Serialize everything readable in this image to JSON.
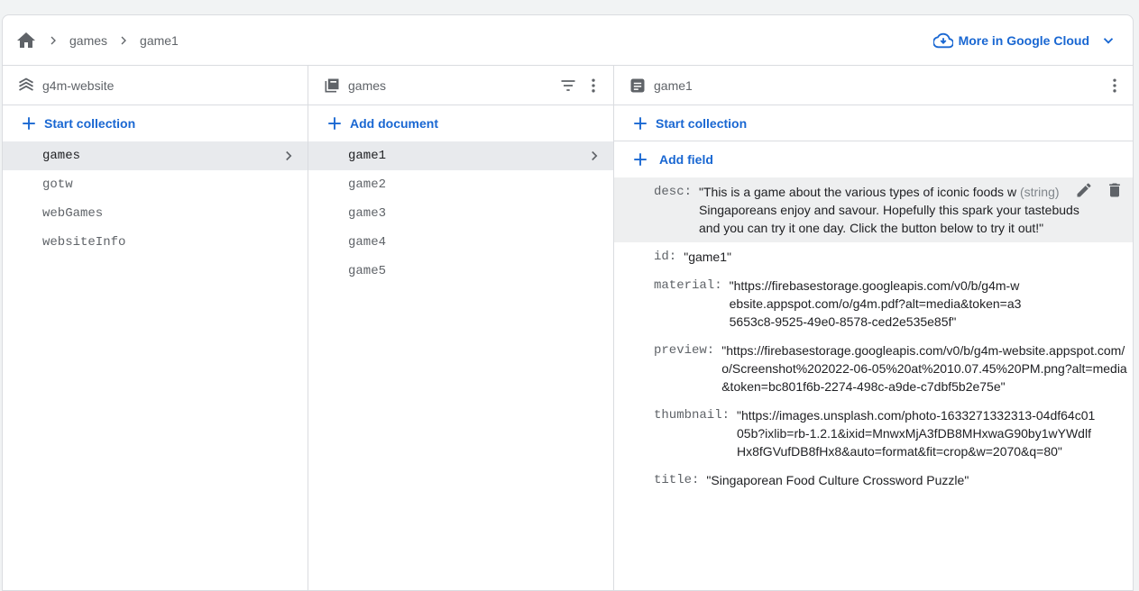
{
  "breadcrumb": [
    "games",
    "game1"
  ],
  "cloud_button": "More in Google Cloud",
  "columns": {
    "root": {
      "title": "g4m-website",
      "action": "Start collection",
      "items": [
        "games",
        "gotw",
        "webGames",
        "websiteInfo"
      ],
      "selected": "games"
    },
    "collection": {
      "title": "games",
      "action": "Add document",
      "items": [
        "game1",
        "game2",
        "game3",
        "game4",
        "game5"
      ],
      "selected": "game1"
    },
    "document": {
      "title": "game1",
      "action1": "Start collection",
      "action2": "Add field",
      "fields": [
        {
          "key": "desc:",
          "value": "\"This is a game about the various types of iconic foods w",
          "value_cont": "Singaporeans enjoy and savour. Hopefully this spark your tastebuds and you can try it one day. Click the button below to try it out!\"",
          "type": "(string)"
        },
        {
          "key": "id:",
          "value": "\"game1\""
        },
        {
          "key": "material:",
          "value": "\"https://firebasestorage.googleapis.com/v0/b/g4m-website.appspot.com/o/g4m.pdf?alt=media&token=a35653c8-9525-49e0-8578-ced2e535e85f\""
        },
        {
          "key": "preview:",
          "value": "\"https://firebasestorage.googleapis.com/v0/b/g4m-website.appspot.com/o/Screenshot%202022-06-05%20at%2010.07.45%20PM.png?alt=media&token=bc801f6b-2274-498c-a9de-c7dbf5b2e75e\""
        },
        {
          "key": "thumbnail:",
          "value": "\"https://images.unsplash.com/photo-1633271332313-04df64c0105b?ixlib=rb-1.2.1&ixid=MnwxMjA3fDB8MHxwaG90by1wYWdlfHx8fGVufDB8fHx8&auto=format&fit=crop&w=2070&q=80\""
        },
        {
          "key": "title:",
          "value": "\"Singaporean Food Culture Crossword Puzzle\""
        }
      ]
    }
  },
  "colors": {
    "accent": "#1967d2",
    "selected_bg": "#e8eaed",
    "border": "#dadce0"
  }
}
